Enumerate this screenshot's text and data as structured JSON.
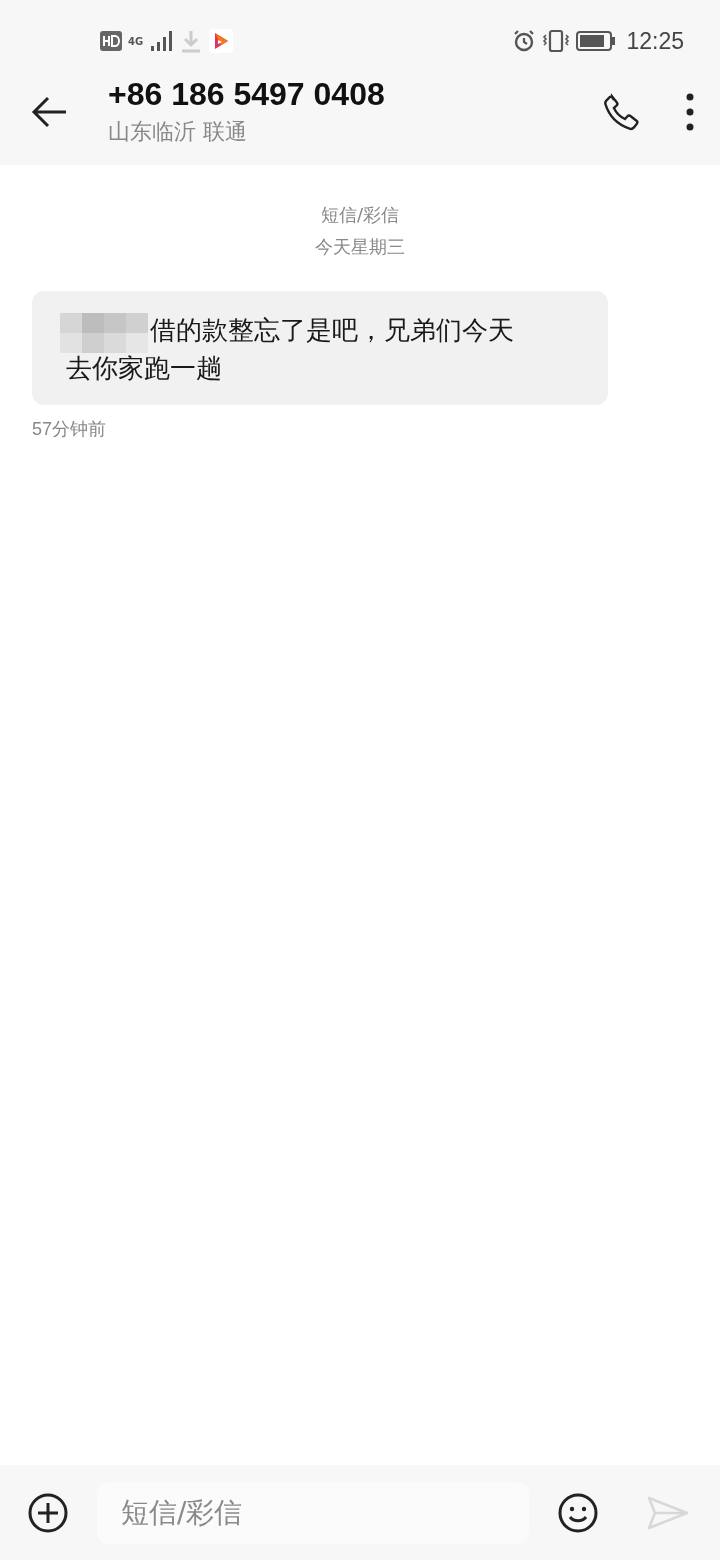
{
  "status_bar": {
    "network": "4G",
    "time": "12:25"
  },
  "header": {
    "title": "+86 186 5497 0408",
    "subtitle": "山东临沂 联通"
  },
  "thread": {
    "channel": "短信/彩信",
    "date": "今天星期三",
    "messages": [
      {
        "lines": [
          "借的款整忘了是吧，兄弟们今天",
          "去你家跑一趟"
        ],
        "redacted": true,
        "time": "57分钟前"
      }
    ]
  },
  "composer": {
    "placeholder": "短信/彩信",
    "send_disabled": true
  }
}
